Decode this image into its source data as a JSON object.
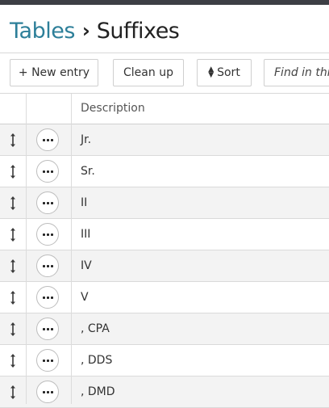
{
  "breadcrumb": {
    "parent": "Tables",
    "separator": "›",
    "current": "Suffixes"
  },
  "toolbar": {
    "new_entry_label": "+ New entry",
    "clean_up_label": "Clean up",
    "sort_label": "Sort",
    "search_placeholder": "Find in this table"
  },
  "table": {
    "columns": [
      "",
      "",
      "Description"
    ],
    "rows": [
      {
        "description": "Jr."
      },
      {
        "description": "Sr."
      },
      {
        "description": "II"
      },
      {
        "description": "III"
      },
      {
        "description": "IV"
      },
      {
        "description": "V"
      },
      {
        "description": ", CPA"
      },
      {
        "description": ", DDS"
      },
      {
        "description": ", DMD"
      }
    ]
  },
  "colors": {
    "accent": "#2d7f99",
    "top_bar": "#3d3f45",
    "row_alt": "#f3f3f3"
  },
  "icons": {
    "drag": "drag-handle-icon",
    "more": "more-options-icon",
    "sort": "sort-icon"
  }
}
